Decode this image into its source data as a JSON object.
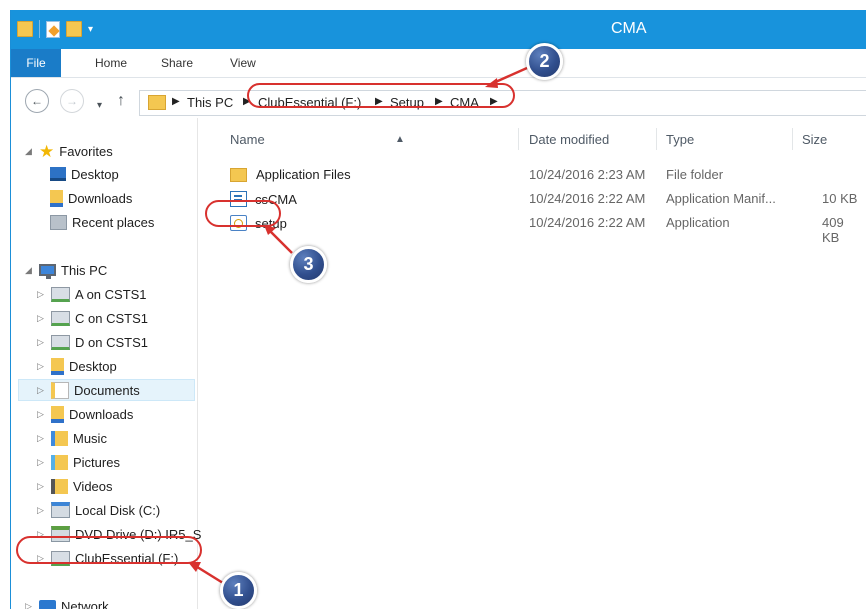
{
  "window": {
    "title": "CMA"
  },
  "ribbon": {
    "tabs": [
      {
        "label": "File"
      },
      {
        "label": "Home"
      },
      {
        "label": "Share"
      },
      {
        "label": "View"
      }
    ]
  },
  "address": {
    "breadcrumbs": [
      {
        "label": "This PC"
      },
      {
        "label": "ClubEssential (F:)"
      },
      {
        "label": "Setup"
      },
      {
        "label": "CMA"
      }
    ]
  },
  "sidebar": {
    "favorites": {
      "label": "Favorites",
      "items": [
        {
          "label": "Desktop"
        },
        {
          "label": "Downloads"
        },
        {
          "label": "Recent places"
        }
      ]
    },
    "this_pc": {
      "label": "This PC",
      "items": [
        {
          "label": "A on CSTS1"
        },
        {
          "label": "C on CSTS1"
        },
        {
          "label": "D on CSTS1"
        },
        {
          "label": "Desktop"
        },
        {
          "label": "Documents"
        },
        {
          "label": "Downloads"
        },
        {
          "label": "Music"
        },
        {
          "label": "Pictures"
        },
        {
          "label": "Videos"
        },
        {
          "label": "Local Disk (C:)"
        },
        {
          "label": "DVD Drive (D:) IR5_S"
        },
        {
          "label": "ClubEssential (F:)"
        }
      ]
    },
    "network": {
      "label": "Network"
    }
  },
  "table": {
    "columns": [
      {
        "label": "Name"
      },
      {
        "label": "Date modified"
      },
      {
        "label": "Type"
      },
      {
        "label": "Size"
      }
    ],
    "rows": [
      {
        "name": "Application Files",
        "date": "10/24/2016 2:23 AM",
        "type": "File folder",
        "size": ""
      },
      {
        "name": "csCMA",
        "date": "10/24/2016 2:22 AM",
        "type": "Application Manif...",
        "size": "10 KB"
      },
      {
        "name": "setup",
        "date": "10/24/2016 2:22 AM",
        "type": "Application",
        "size": "409 KB"
      }
    ]
  },
  "annotations": [
    {
      "label": "1"
    },
    {
      "label": "2"
    },
    {
      "label": "3"
    }
  ],
  "colors": {
    "titlebar": "#1893dc",
    "file_tab": "#1a7cc8",
    "annotation": "#d8312e",
    "badge": "#314f8e"
  },
  "icons": {
    "back": "back-arrow-icon",
    "forward": "forward-arrow-icon",
    "up": "up-arrow-icon",
    "folder": "folder-icon",
    "manifest": "manifest-icon",
    "application": "application-icon"
  }
}
